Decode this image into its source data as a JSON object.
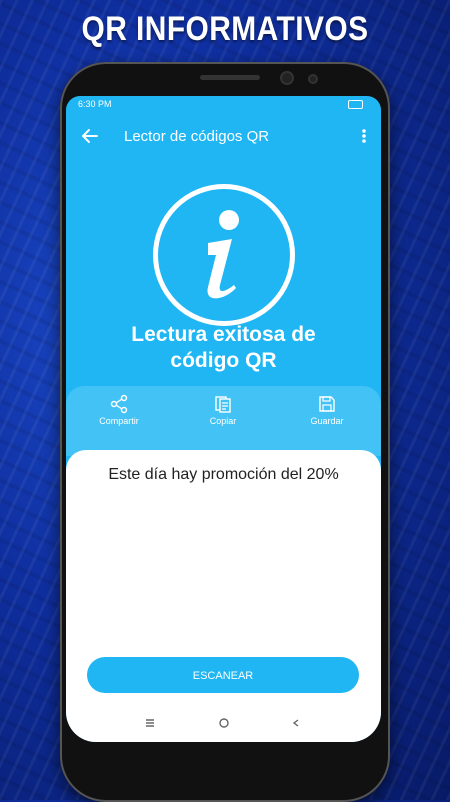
{
  "promo": {
    "title": "QR INFORMATIVOS"
  },
  "status_bar": {
    "time": "6:30 PM"
  },
  "app_bar": {
    "title": "Lector de códigos QR",
    "back_icon": "arrow-left-icon",
    "menu_icon": "more-vert-icon"
  },
  "result": {
    "icon": "info-icon",
    "headline_line1": "Lectura exitosa de",
    "headline_line2": "código QR",
    "content": "Este día hay promoción del 20%"
  },
  "actions": [
    {
      "label": "Compartir",
      "icon": "share-icon"
    },
    {
      "label": "Copiar",
      "icon": "copy-icon"
    },
    {
      "label": "Guardar",
      "icon": "save-icon"
    }
  ],
  "scan_button": {
    "label": "ESCANEAR"
  },
  "colors": {
    "primary": "#1fb6f3",
    "panel": "#43c3f5",
    "background": "#0f2fa0"
  }
}
